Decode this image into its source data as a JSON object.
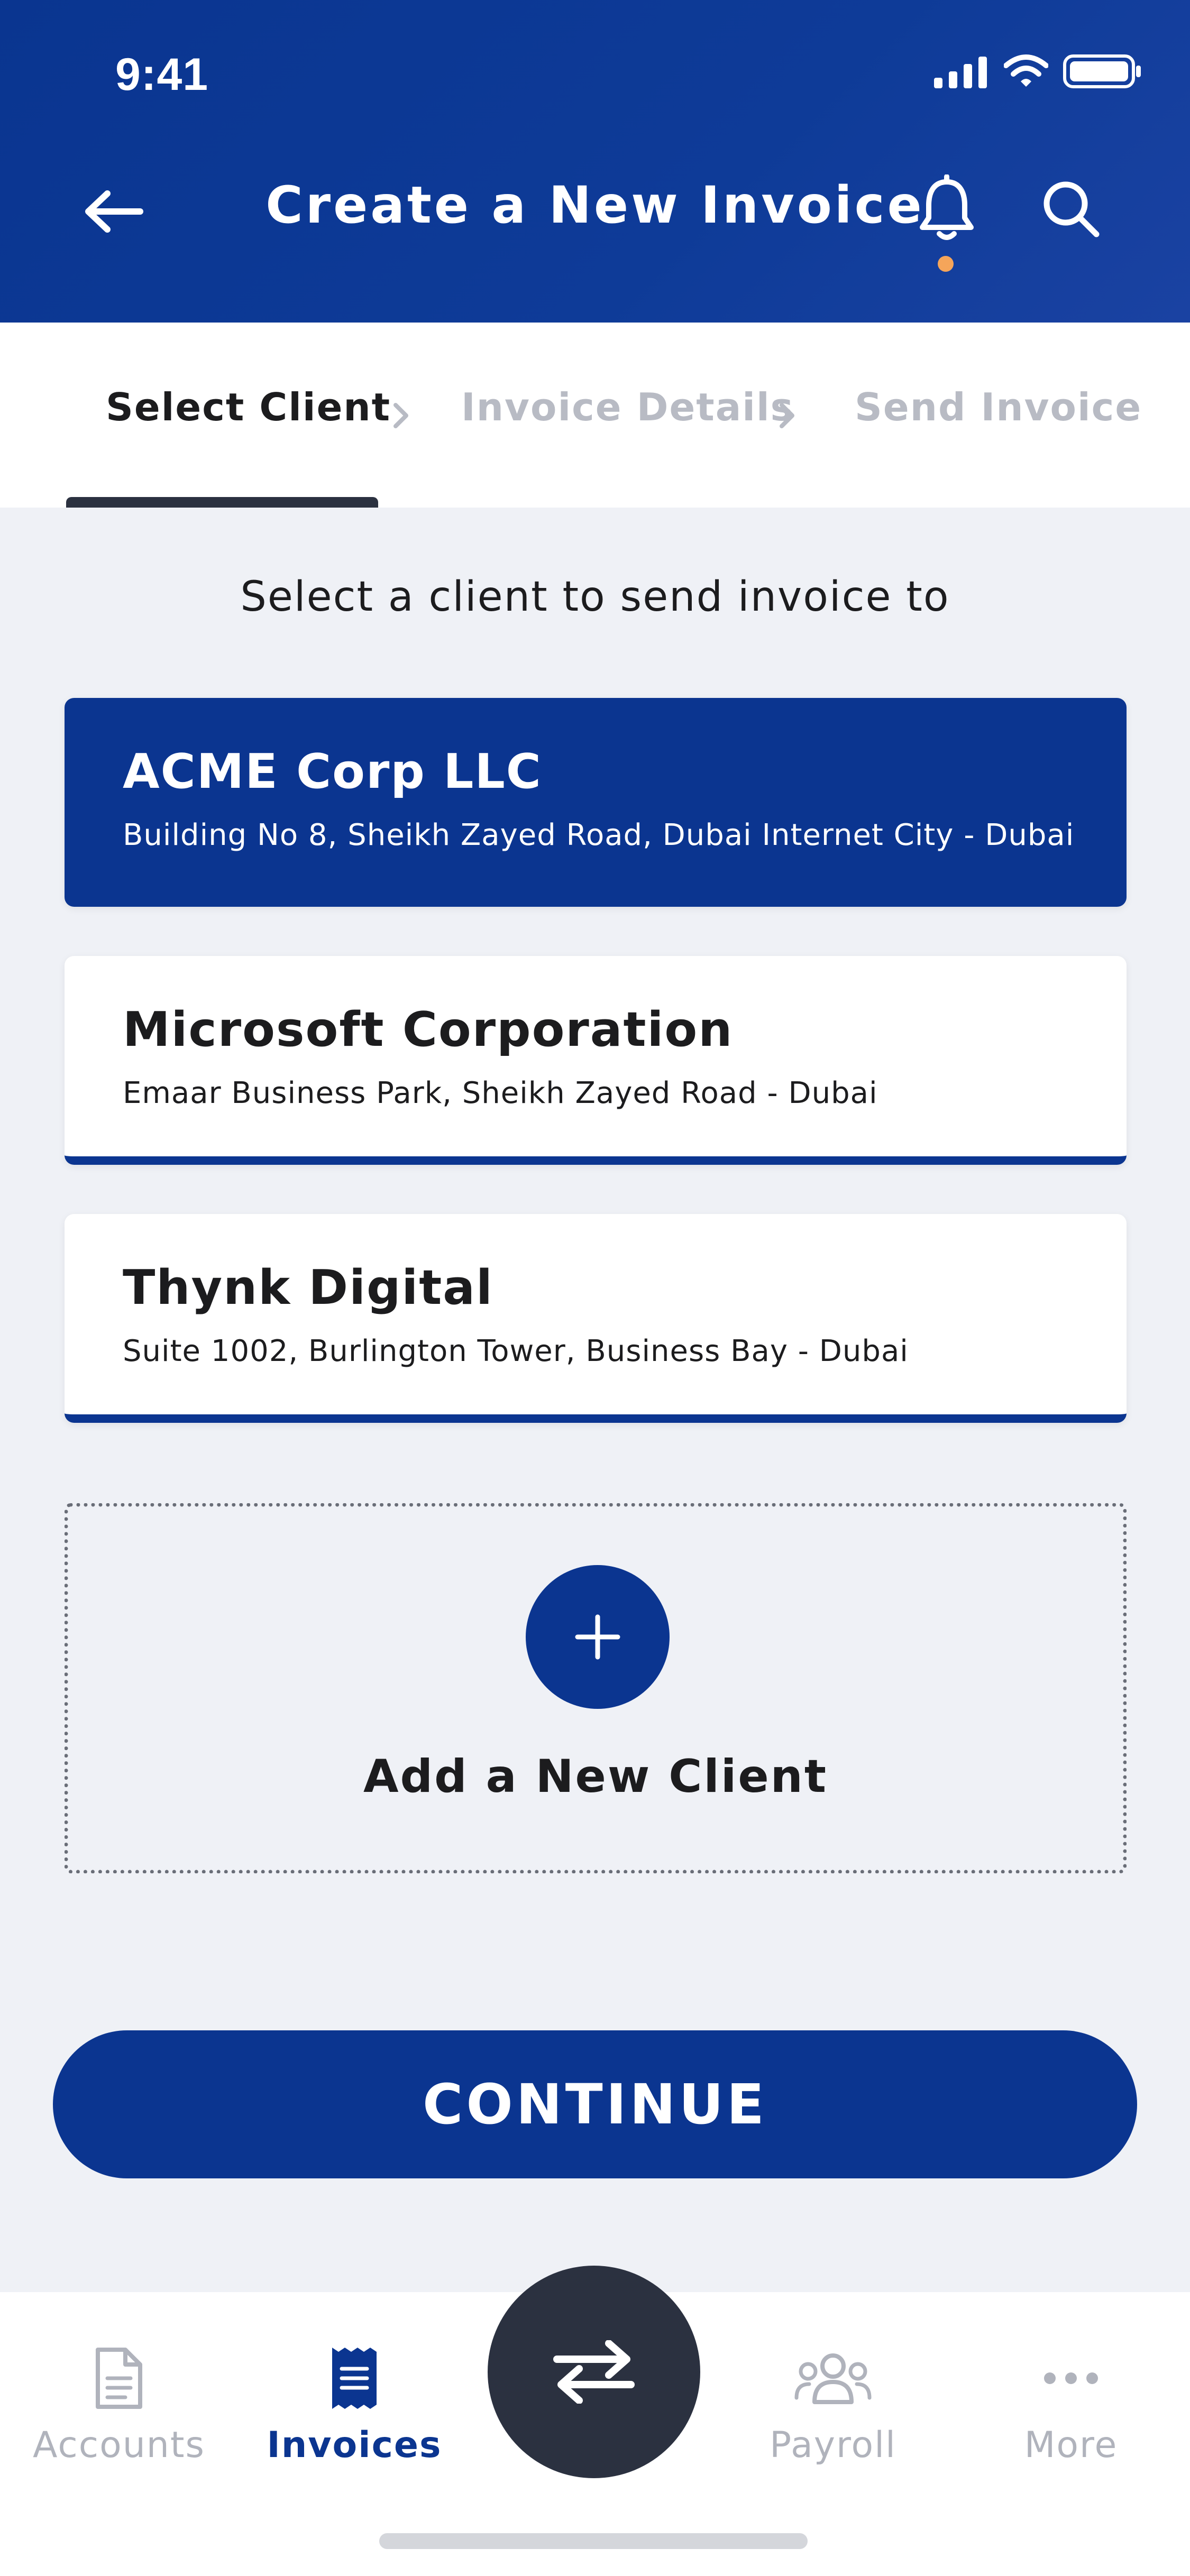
{
  "status_bar": {
    "time": "9:41"
  },
  "header": {
    "title": "Create a New Invoice",
    "back_icon": "arrow-left-icon",
    "notification_icon": "bell-icon",
    "search_icon": "search-icon",
    "notification_dot_color": "#F5A55A"
  },
  "stepper": {
    "steps": [
      {
        "label": "Select Client",
        "active": true
      },
      {
        "label": "Invoice Details",
        "active": false
      },
      {
        "label": "Send Invoice",
        "active": false
      }
    ]
  },
  "main": {
    "prompt": "Select a client to send invoice to",
    "clients": [
      {
        "name": "ACME Corp LLC",
        "address": "Building No 8, Sheikh Zayed Road, Dubai Internet City - Dubai",
        "selected": true
      },
      {
        "name": "Microsoft Corporation",
        "address": "Emaar Business Park, Sheikh Zayed Road - Dubai",
        "selected": false
      },
      {
        "name": "Thynk Digital",
        "address": "Suite 1002, Burlington Tower, Business Bay - Dubai",
        "selected": false
      }
    ],
    "add_client_label": "Add a New Client",
    "continue_label": "CONTINUE"
  },
  "tabbar": {
    "tabs": [
      {
        "label": "Accounts",
        "icon": "document-icon",
        "active": false
      },
      {
        "label": "Invoices",
        "icon": "receipt-icon",
        "active": true
      },
      {
        "label": "Payroll",
        "icon": "people-icon",
        "active": false
      },
      {
        "label": "More",
        "icon": "more-icon",
        "active": false
      }
    ],
    "center_action_icon": "transfer-arrows-icon"
  },
  "colors": {
    "primary": "#0B3590",
    "dark": "#2B3140",
    "background": "#EFF1F6",
    "inactive": "#B0B3BC"
  }
}
